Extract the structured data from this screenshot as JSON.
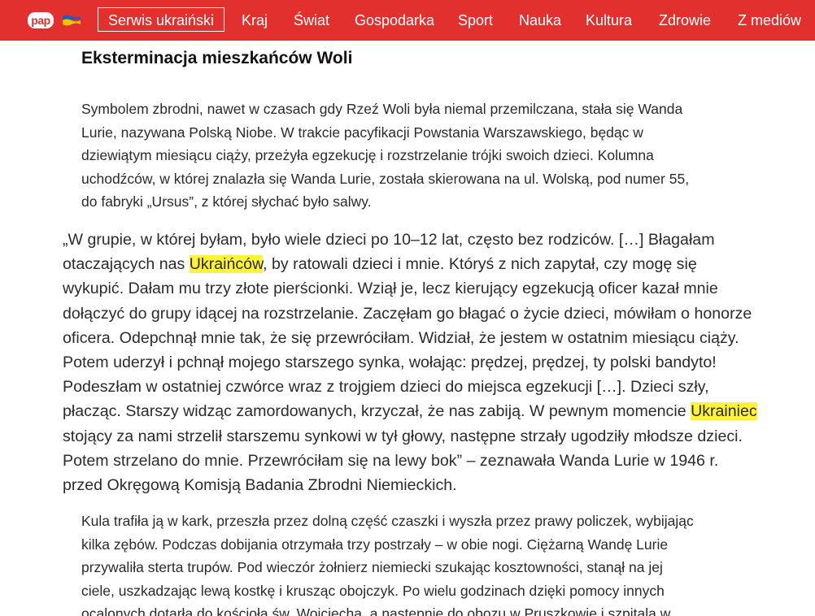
{
  "header": {
    "logo_text": "pap",
    "flag_colors": [
      "#1f5fbf",
      "#f5c400"
    ],
    "background": "#e2302f",
    "nav": [
      {
        "label": "Serwis ukraiński",
        "active": true
      },
      {
        "label": "Kraj"
      },
      {
        "label": "Świat"
      },
      {
        "label": "Gospodarka"
      },
      {
        "label": "Sport"
      },
      {
        "label": "Nauka"
      },
      {
        "label": "Kultura"
      },
      {
        "label": "Zdrowie"
      },
      {
        "label": "Z mediów"
      }
    ]
  },
  "article": {
    "heading": "Eksterminacja mieszkańców Woli",
    "intro_lines": [
      "Symbolem zbrodni, nawet w czasach gdy Rzeź Woli była niemal przemilczana, stała się Wanda",
      "Lurie, nazywana Polską Niobe. W trakcie pacyfikacji Powstania Warszawskiego, będąc w",
      "dziewiątym miesiącu ciąży, przeżyła egzekucję i rozstrzelanie trójki swoich dzieci. Kolumna",
      "uchodźców, w której znalazła się Wanda Lurie, została skierowana na ul. Wolską, pod numer 55,",
      "do fabryki „Ursus”, z której słychać było salwy."
    ],
    "quote": {
      "l1": "„W grupie, w której byłam, było wiele dzieci po 10–12 lat, często bez rodziców. […] Błagałam",
      "l2_before": "otaczających nas ",
      "l2_highlight": "Ukraińców",
      "l2_after": ", by ratowali dzieci i mnie. Któryś z nich zapytał, czy mogę się",
      "l3": "wykupić. Dałam mu trzy złote pierścionki. Wziął je, lecz kierujący egzekucją oficer kazał mnie",
      "l4": "dołączyć do grupy idącej na rozstrzelanie. Zaczęłam go błagać o życie dzieci, mówiłam o honorze",
      "l5": "oficera. Odepchnął mnie tak, że się przewróciłam. Widział, że jestem w ostatnim miesiącu ciąży.",
      "l6": "Potem uderzył i pchnął mojego starszego synka, wołając: prędzej, prędzej, ty polski bandyto!",
      "l7": "Podeszłam w ostatniej czwórce wraz z trojgiem dzieci do miejsca egzekucji […]. Dzieci szły,",
      "l8_before": "płacząc. Starszy widząc zamordowanych, krzyczał, że nas zabiją. W pewnym momencie ",
      "l8_highlight": "Ukrainiec ",
      "l9": "stojący za nami strzelił starszemu synkowi w tył głowy, następne strzały ugodziły młodsze dzieci.",
      "l10": "Potem strzelano do mnie. Przewróciłam się na lewy bok” – zeznawała Wanda Lurie w 1946 r.",
      "l11": "przed Okręgową Komisją Badania Zbrodni Niemieckich."
    },
    "outro_lines": [
      "Kula trafiła ją w kark, przeszła przez dolną część czaszki i wyszła przez prawy policzek, wybijając",
      "kilka zębów. Podczas dobijania otrzymała trzy postrzały – w obie nogi. Ciężarną Wandę Lurie",
      "przywaliła sterta trupów. Pod wieczór żołnierz niemiecki szukając kosztowności, stanął na jej",
      "ciele, uszkadzając lewą kostkę i krusząc obojczyk. Po wielu godzinach dzięki pomocy innych",
      "ocalonych dotarła do kościoła św. Wojciecha, a następnie do obozu w Pruszkowie i szpitala w"
    ]
  }
}
